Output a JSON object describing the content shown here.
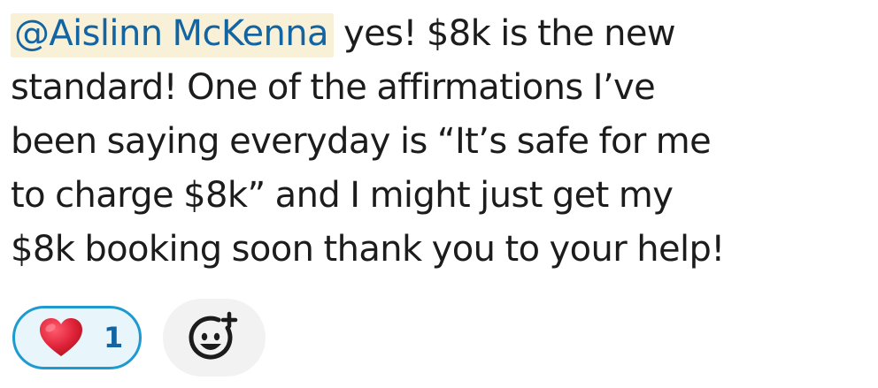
{
  "message": {
    "mention": "@Aislinn McKenna",
    "line1": " yes! $8k is the new",
    "line2": "standard! One of the affirmations I’ve",
    "line3": "been saying everyday is “It’s safe for me",
    "line4": "to charge $8k” and I might just get my",
    "line5": "$8k booking soon thank you to your help!"
  },
  "reactions": [
    {
      "icon": "red-heart-icon",
      "count": "1",
      "color": "#e0245e"
    }
  ],
  "add_reaction": {
    "icon": "add-reaction-icon"
  },
  "colors": {
    "text": "#1d1c1d",
    "mention_text": "#1264a3",
    "mention_background": "#f8f0d7",
    "reaction_border": "#1d9bd1",
    "reaction_background": "#e8f5fa",
    "add_reaction_background": "#f2f2f2"
  }
}
